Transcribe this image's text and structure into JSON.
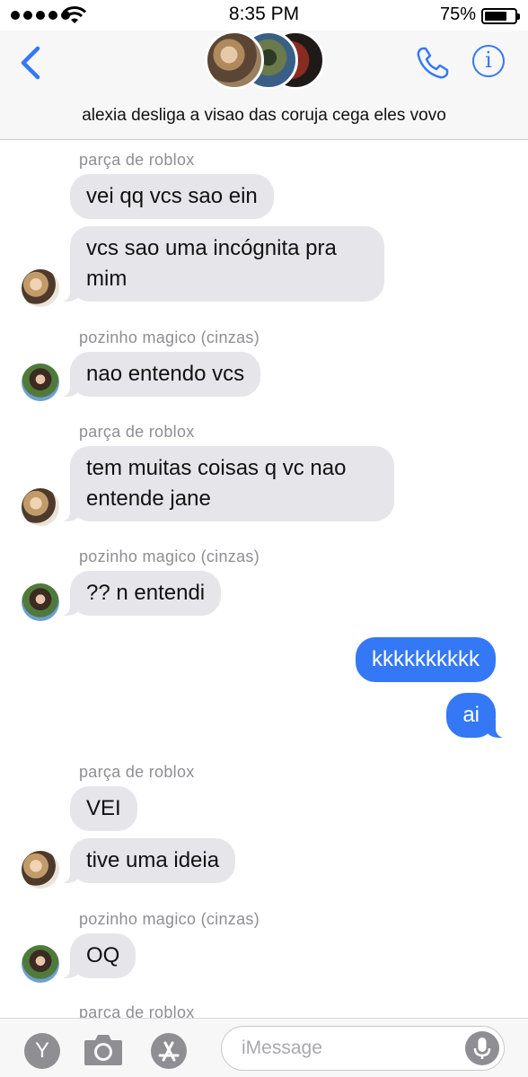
{
  "status_bar": {
    "time": "8:35 PM",
    "battery": "75%",
    "battery_level": 0.75
  },
  "header": {
    "group_name": "alexia desliga a visao das coruja cega eles vovo",
    "icons": [
      "back-chevron-icon",
      "phone-icon",
      "info-icon"
    ]
  },
  "messages": [
    {
      "sender": "parça de roblox"
    },
    {
      "text": "vei qq vcs sao ein"
    },
    {
      "text": "vcs sao uma incógnita pra\nmim"
    },
    {
      "sender": "pozinho magico (cinzas)"
    },
    {
      "text": "nao entendo vcs"
    },
    {
      "sender": "parça de roblox"
    },
    {
      "text": "tem muitas coisas q vc nao\nentende jane"
    },
    {
      "sender": "pozinho magico (cinzas)"
    },
    {
      "text": "?? n entendi"
    },
    {
      "text": "kkkkkkkkkk"
    },
    {
      "text": "ai"
    },
    {
      "sender": "parça de roblox"
    },
    {
      "text": "VEI"
    },
    {
      "text": "tive uma ideia"
    },
    {
      "sender": "pozinho magico (cinzas)"
    },
    {
      "text": "OQ"
    },
    {
      "sender": "parça de roblox"
    }
  ],
  "bottom_bar": {
    "apps_icon_label": "Y",
    "placeholder": "iMessage",
    "icons": [
      "apps-icon",
      "camera-icon",
      "app-store-icon",
      "microphone-icon"
    ]
  },
  "colors": {
    "accent": "#3478f6",
    "incoming": "#e5e5ea",
    "outgoing": "#3478f6",
    "sender_label": "#8e8e93"
  }
}
